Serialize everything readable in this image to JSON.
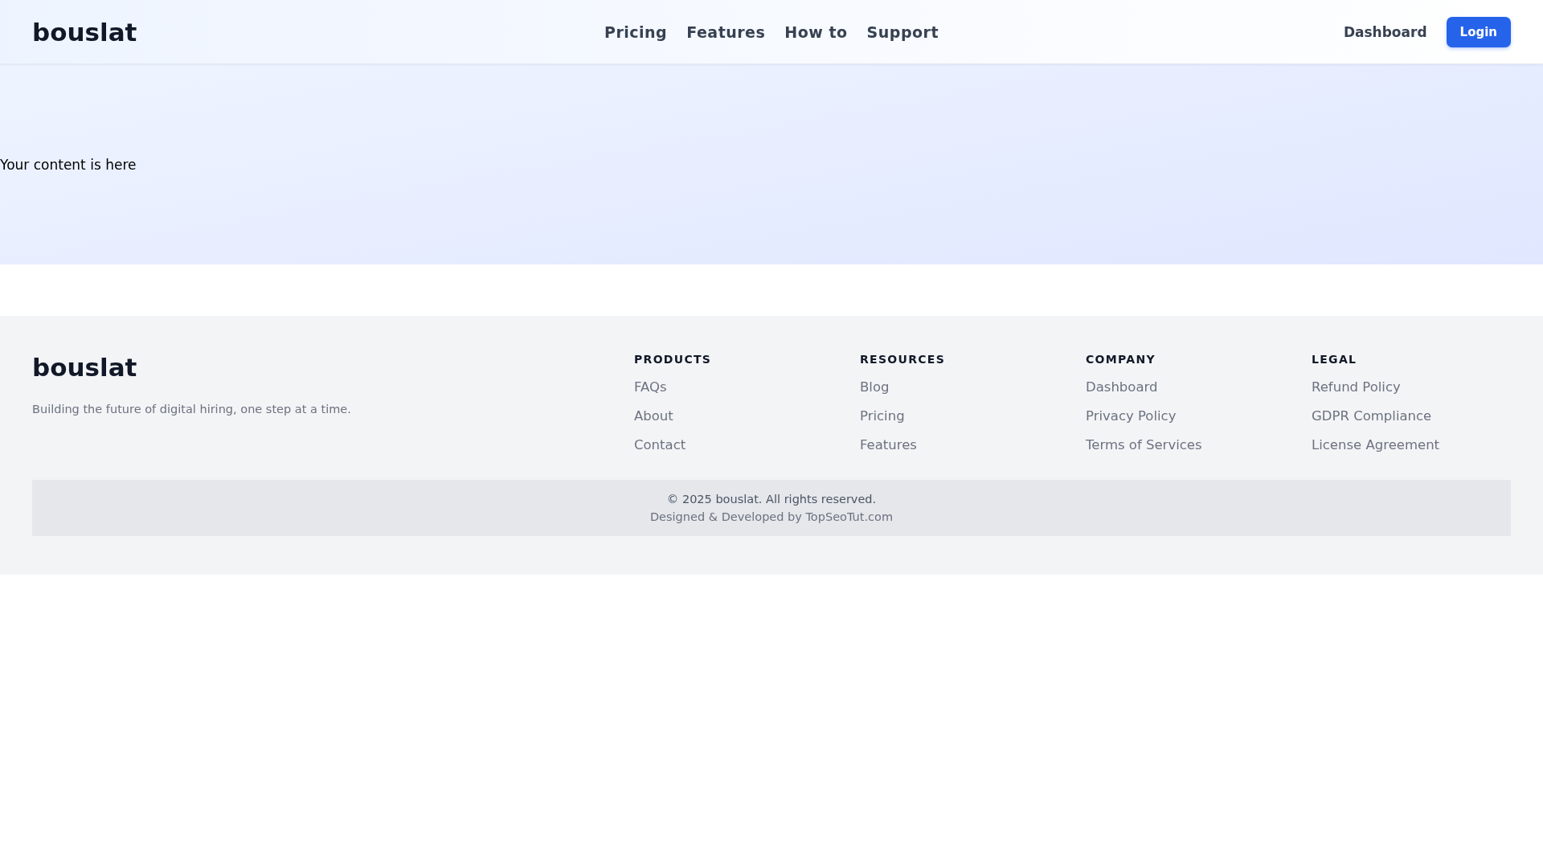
{
  "header": {
    "logo": "bouslat",
    "nav": [
      "Pricing",
      "Features",
      "How to",
      "Support"
    ],
    "dashboard_link": "Dashboard",
    "login_button": "Login"
  },
  "hero": {
    "text": "Your content is here"
  },
  "footer": {
    "logo": "bouslat",
    "tagline": "Building the future of digital hiring, one step at a time.",
    "columns": [
      {
        "heading": "PRODUCTS",
        "links": [
          "FAQs",
          "About",
          "Contact"
        ]
      },
      {
        "heading": "RESOURCES",
        "links": [
          "Blog",
          "Pricing",
          "Features"
        ]
      },
      {
        "heading": "COMPANY",
        "links": [
          "Dashboard",
          "Privacy Policy",
          "Terms of Services"
        ]
      },
      {
        "heading": "LEGAL",
        "links": [
          "Refund Policy",
          "GDPR Compliance",
          "License Agreement"
        ]
      }
    ],
    "copyright": "© 2025 bouslat. All rights reserved.",
    "credit": "Designed & Developed by TopSeoTut.com"
  }
}
